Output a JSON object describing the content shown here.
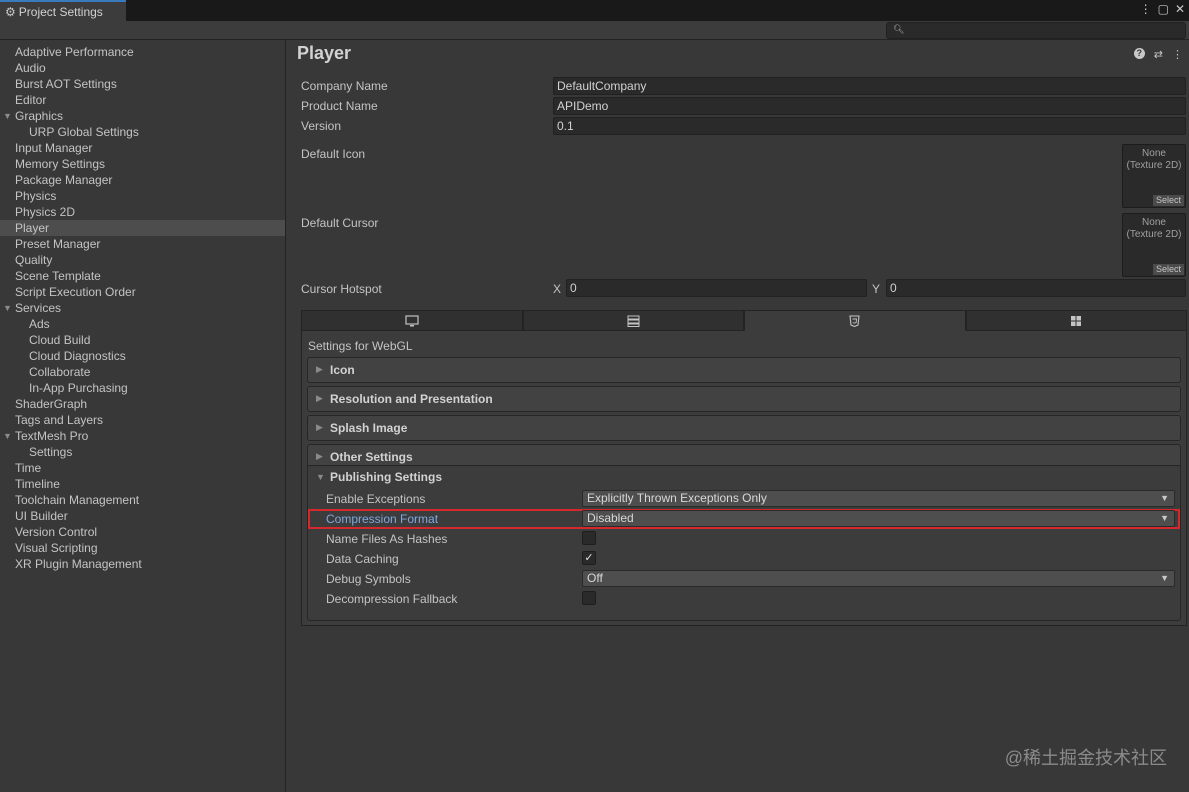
{
  "window": {
    "tab_title": "Project Settings",
    "tab_icon": "gear-icon",
    "controls": [
      "more-icon",
      "maximize-icon",
      "close-icon"
    ]
  },
  "search": {
    "placeholder": ""
  },
  "sidebar": {
    "items": [
      {
        "label": "Adaptive Performance",
        "level": 0
      },
      {
        "label": "Audio",
        "level": 0
      },
      {
        "label": "Burst AOT Settings",
        "level": 0
      },
      {
        "label": "Editor",
        "level": 0
      },
      {
        "label": "Graphics",
        "level": 0,
        "expanded": true
      },
      {
        "label": "URP Global Settings",
        "level": 1
      },
      {
        "label": "Input Manager",
        "level": 0
      },
      {
        "label": "Memory Settings",
        "level": 0
      },
      {
        "label": "Package Manager",
        "level": 0
      },
      {
        "label": "Physics",
        "level": 0
      },
      {
        "label": "Physics 2D",
        "level": 0
      },
      {
        "label": "Player",
        "level": 0,
        "selected": true
      },
      {
        "label": "Preset Manager",
        "level": 0
      },
      {
        "label": "Quality",
        "level": 0
      },
      {
        "label": "Scene Template",
        "level": 0
      },
      {
        "label": "Script Execution Order",
        "level": 0
      },
      {
        "label": "Services",
        "level": 0,
        "expanded": true
      },
      {
        "label": "Ads",
        "level": 1
      },
      {
        "label": "Cloud Build",
        "level": 1
      },
      {
        "label": "Cloud Diagnostics",
        "level": 1
      },
      {
        "label": "Collaborate",
        "level": 1
      },
      {
        "label": "In-App Purchasing",
        "level": 1
      },
      {
        "label": "ShaderGraph",
        "level": 0
      },
      {
        "label": "Tags and Layers",
        "level": 0
      },
      {
        "label": "TextMesh Pro",
        "level": 0,
        "expanded": true
      },
      {
        "label": "Settings",
        "level": 1
      },
      {
        "label": "Time",
        "level": 0
      },
      {
        "label": "Timeline",
        "level": 0
      },
      {
        "label": "Toolchain Management",
        "level": 0
      },
      {
        "label": "UI Builder",
        "level": 0
      },
      {
        "label": "Version Control",
        "level": 0
      },
      {
        "label": "Visual Scripting",
        "level": 0
      },
      {
        "label": "XR Plugin Management",
        "level": 0
      }
    ]
  },
  "main": {
    "title": "Player",
    "header_icons": [
      "help-icon",
      "preset-icon",
      "more-icon"
    ],
    "company_name_label": "Company Name",
    "company_name": "DefaultCompany",
    "product_name_label": "Product Name",
    "product_name": "APIDemo",
    "version_label": "Version",
    "version": "0.1",
    "default_icon_label": "Default Icon",
    "default_cursor_label": "Default Cursor",
    "texture_none": "None",
    "texture_type": "(Texture 2D)",
    "texture_select": "Select",
    "cursor_hotspot_label": "Cursor Hotspot",
    "hotspot_x_label": "X",
    "hotspot_x": "0",
    "hotspot_y_label": "Y",
    "hotspot_y": "0",
    "platform_tabs": [
      {
        "icon": "desktop-icon"
      },
      {
        "icon": "dedicated-server-icon"
      },
      {
        "icon": "webgl-icon",
        "active": true
      },
      {
        "icon": "windows-icon"
      }
    ],
    "settings_for": "Settings for WebGL",
    "foldouts": [
      "Icon",
      "Resolution and Presentation",
      "Splash Image",
      "Other Settings"
    ],
    "publishing": {
      "title": "Publishing Settings",
      "enable_exceptions_label": "Enable Exceptions",
      "enable_exceptions_value": "Explicitly Thrown Exceptions Only",
      "compression_format_label": "Compression Format",
      "compression_format_value": "Disabled",
      "name_files_as_hashes_label": "Name Files As Hashes",
      "name_files_as_hashes": false,
      "data_caching_label": "Data Caching",
      "data_caching": true,
      "debug_symbols_label": "Debug Symbols",
      "debug_symbols_value": "Off",
      "decompression_fallback_label": "Decompression Fallback",
      "decompression_fallback": false
    }
  },
  "watermark": "@稀土掘金技术社区",
  "colors": {
    "highlight_border": "#d4282c",
    "accent_tab": "#3a79bb"
  }
}
